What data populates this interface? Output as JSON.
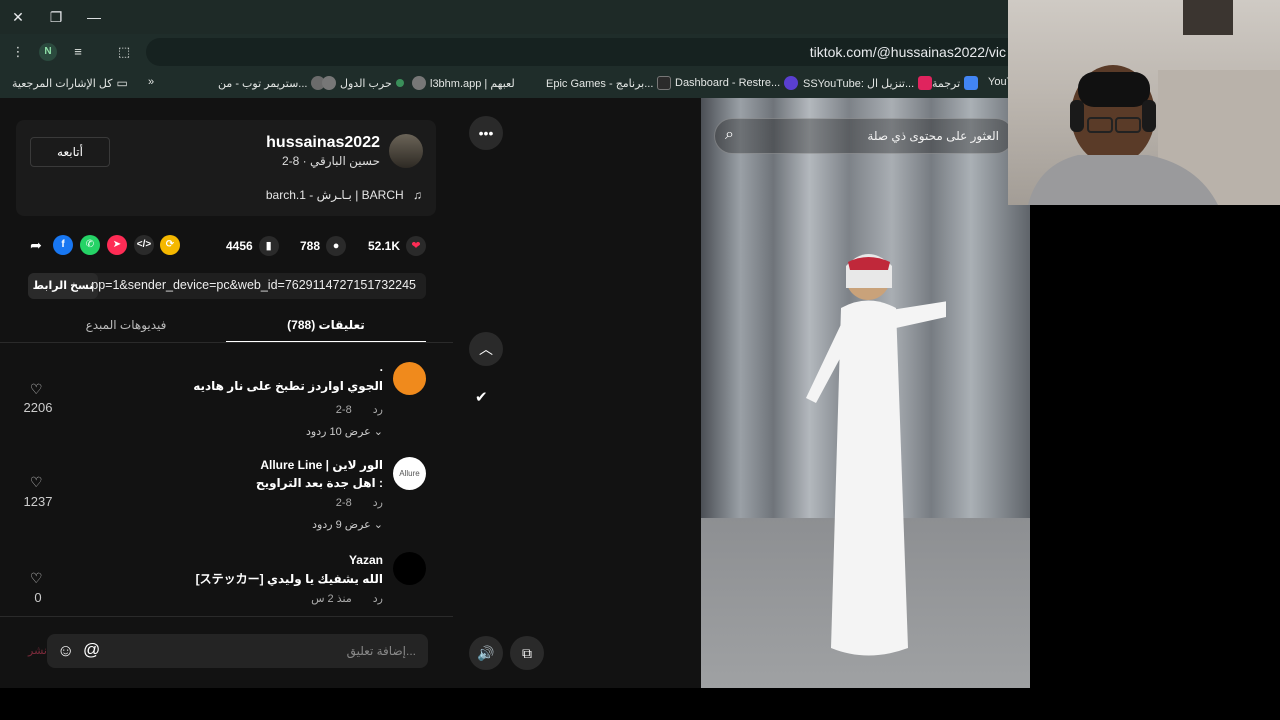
{
  "browser": {
    "url": "tiktok.com/@hussainas2022/vic",
    "profile_initial": "N",
    "bookmarks": {
      "all_bookmarks": "كل الإشارات المرجعية",
      "items": [
        {
          "label": "ستريمر توب - من...",
          "color": "#6b6b6b"
        },
        {
          "label": "حرب الدول",
          "color": "#3a8f5a"
        },
        {
          "label": "l3bhm.app | لعبهم",
          "color": "#888888"
        },
        {
          "label": "Epic Games - برنامج...",
          "color": "#2b2b2b"
        },
        {
          "label": "Dashboard - Restre...",
          "color": "#5a3fd1"
        },
        {
          "label": "SSYouTube: تنزيل ال...",
          "color": "#e0245e"
        },
        {
          "label": "ترجمة",
          "color": "#4285f4"
        },
        {
          "label": "YouT",
          "color": "#ff0000"
        }
      ]
    }
  },
  "creator": {
    "username": "hussainas2022",
    "subtitle": "حسين البارقي · 8-2",
    "follow_label": "أتابعه",
    "music": "barch.1 - بـاـرش | BARCH"
  },
  "stats": {
    "likes": "52.1K",
    "comments": "788",
    "saves": "4456"
  },
  "share": {
    "link_text": "...pp=1&sender_device=pc&web_id=7629114727151732245",
    "copy_label": "نسخ الرابط"
  },
  "tabs": {
    "comments": "(788) تعليقات",
    "creator_videos": "فيديوهات المبدع"
  },
  "comments": [
    {
      "user": ".",
      "text": "الجوي اواردز تطبخ على نار هاديه",
      "date": "8-2",
      "reply": "رد",
      "replies": "عرض 10 ردود",
      "likes": "2206",
      "avatar_color": "#f08a1c"
    },
    {
      "user": "Allure Line | الور لاين",
      "text": "اهل جدة بعد التراويح :",
      "date": "8-2",
      "reply": "رد",
      "replies": "عرض 9 ردود",
      "likes": "1237",
      "avatar_color": "#ffffff",
      "avatar_text": "Allure"
    },
    {
      "user": "Yazan",
      "text": "[ステッカー] الله يشفيك يا وليدي",
      "date": "منذ 2 س",
      "reply": "رد",
      "likes": "0",
      "avatar_color": "#000000"
    }
  ],
  "composer": {
    "placeholder": "إضافة تعليق...",
    "post_label": "نشر"
  },
  "video": {
    "search_placeholder": "العثور على محتوى ذي صلة"
  },
  "icons": {
    "more": "more-horizontal-icon",
    "up": "chevron-up-icon",
    "volume": "volume-icon",
    "pip": "picture-in-picture-icon"
  }
}
